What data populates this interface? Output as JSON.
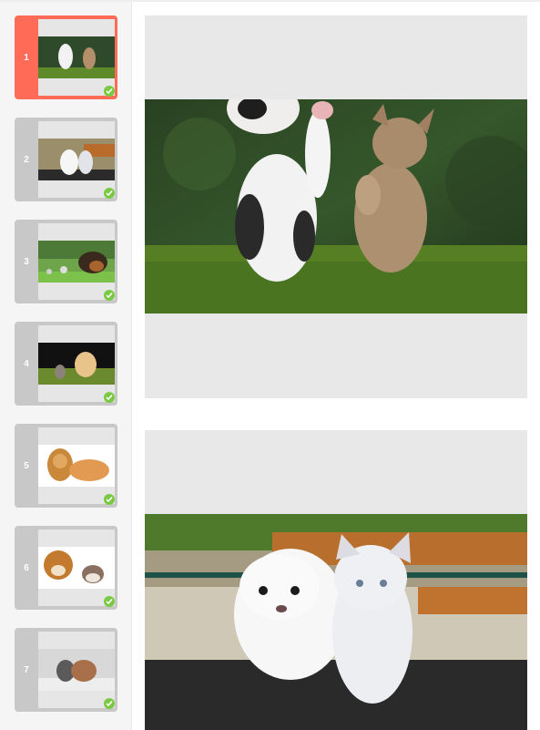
{
  "sidebar": {
    "thumbnails": [
      {
        "number": "1",
        "active": true,
        "status": "check-icon"
      },
      {
        "number": "2",
        "active": false,
        "status": "check-icon"
      },
      {
        "number": "3",
        "active": false,
        "status": "check-icon"
      },
      {
        "number": "4",
        "active": false,
        "status": "check-icon"
      },
      {
        "number": "5",
        "active": false,
        "status": "check-icon"
      },
      {
        "number": "6",
        "active": false,
        "status": "check-icon"
      },
      {
        "number": "7",
        "active": false,
        "status": "check-icon"
      }
    ]
  },
  "colors": {
    "active_thumb": "#ff6b57",
    "inactive_thumb": "#c8c8c8",
    "check": "#7ac943",
    "page_bg": "#e8e8e8"
  }
}
